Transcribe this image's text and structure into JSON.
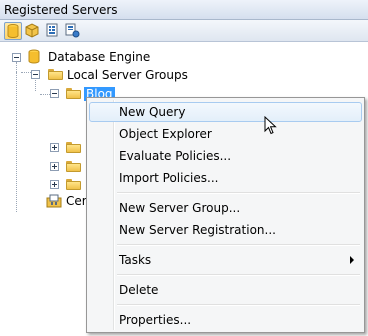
{
  "window": {
    "title": "Registered Servers"
  },
  "toolbar": {
    "buttons": [
      "database-engine-icon",
      "analysis-services-icon",
      "reporting-services-icon",
      "integration-services-icon"
    ]
  },
  "tree": {
    "root": {
      "label": "Database Engine"
    },
    "group": {
      "label": "Local Server Groups"
    },
    "selected": {
      "label": "Blog"
    },
    "partial": {
      "label": "Cer"
    }
  },
  "context_menu": {
    "items": [
      {
        "label": "New Query"
      },
      {
        "label": "Object Explorer"
      },
      {
        "label": "Evaluate Policies..."
      },
      {
        "label": "Import Policies..."
      },
      {
        "label": "New Server Group..."
      },
      {
        "label": "New Server Registration..."
      },
      {
        "label": "Tasks"
      },
      {
        "label": "Delete"
      },
      {
        "label": "Properties..."
      }
    ]
  }
}
